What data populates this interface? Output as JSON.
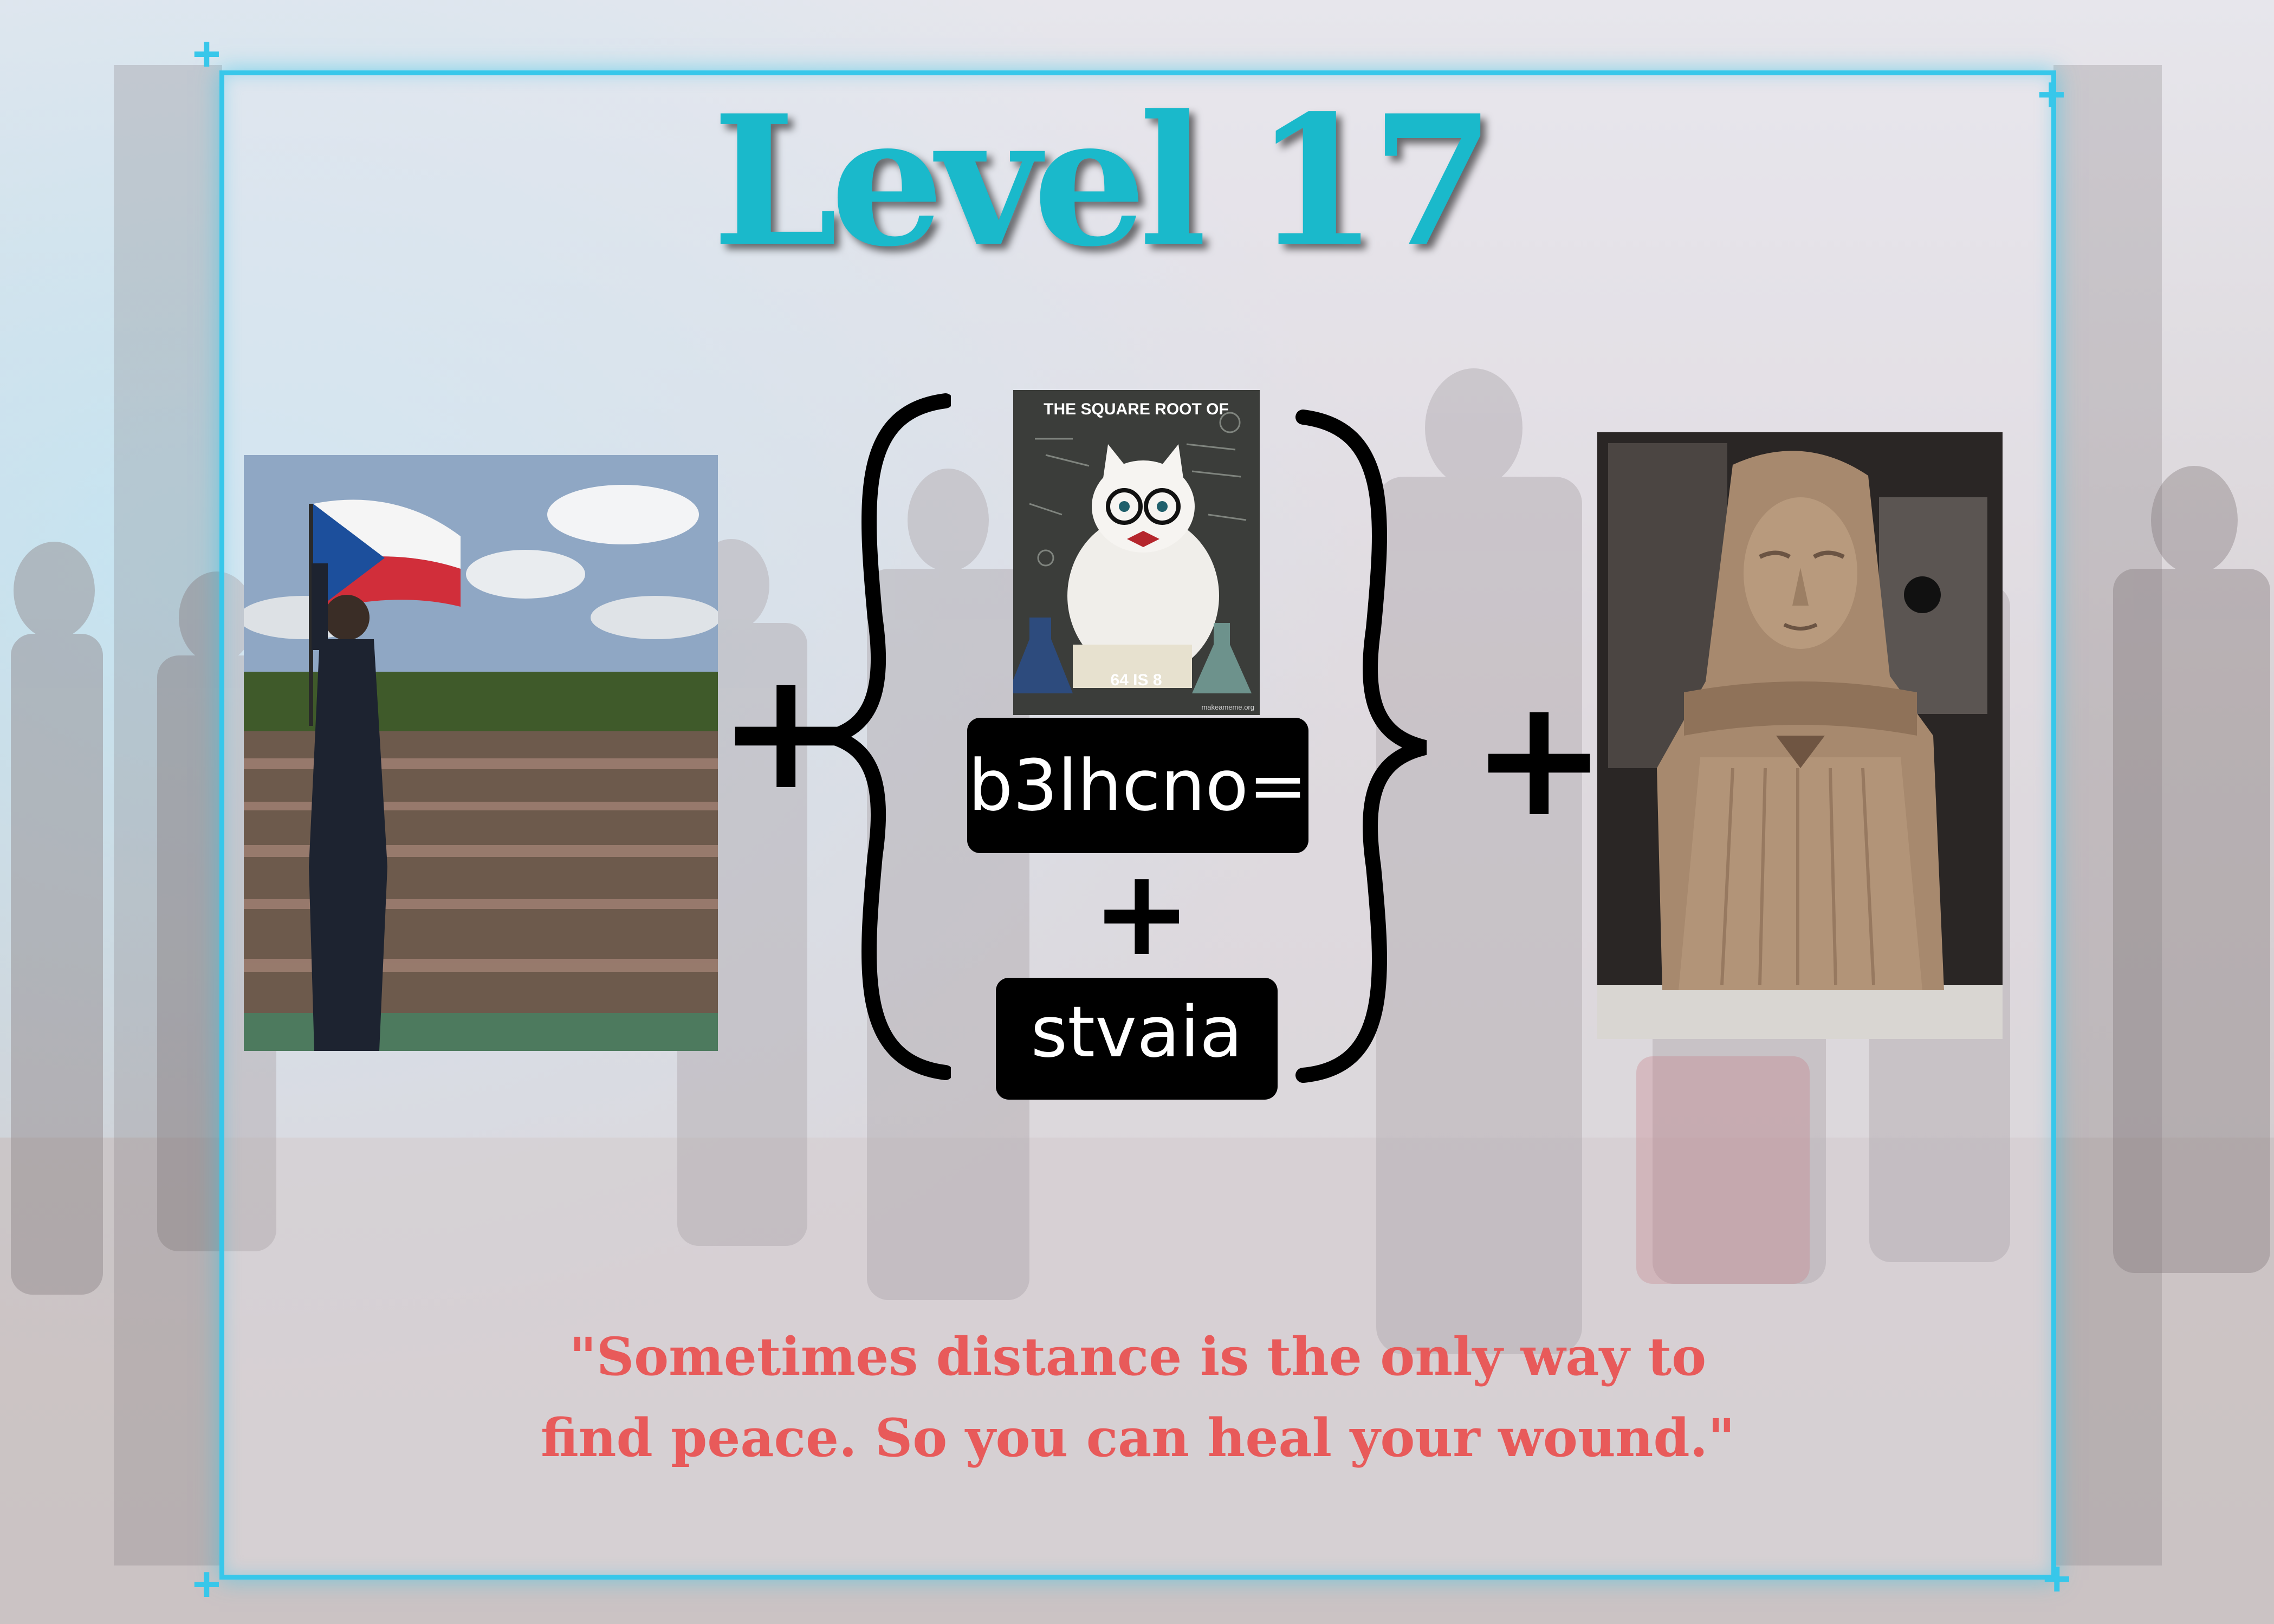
{
  "title": "Level 17",
  "clue_left": {
    "icon": "czech-flag-crowd-photo"
  },
  "clue_middle": {
    "meme_top_text": "THE SQUARE ROOT OF",
    "meme_bottom_text": "64 IS 8",
    "meme_credit": "makeameme.org",
    "code_1": "b3lhcno=",
    "code_2": "stvaia"
  },
  "clue_right": {
    "icon": "ancient-bust-statue-photo"
  },
  "operators": {
    "plus": "+"
  },
  "quote": {
    "line1": "\"Sometimes distance is the only way to",
    "line2": "find peace. So you can heal your wound.\""
  },
  "colors": {
    "title": "#1ab9cb",
    "frame": "#37c7ea",
    "quote": "#e85a5a"
  }
}
